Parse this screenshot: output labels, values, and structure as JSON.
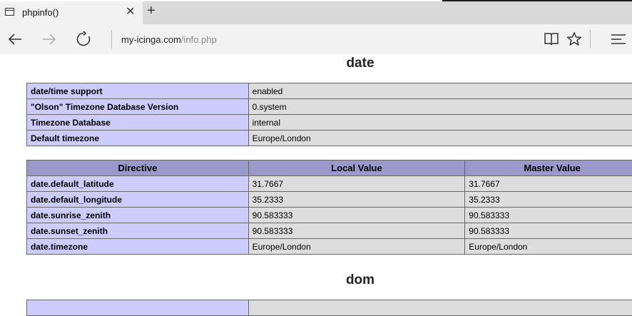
{
  "tab": {
    "title": "phpinfo()",
    "close": "✕",
    "new_tab": "+"
  },
  "address": {
    "host": "my-icinga.com",
    "path": "/info.php"
  },
  "sections": {
    "date_title": "date",
    "dom_title": "dom"
  },
  "date_info": [
    {
      "name": "date/time support",
      "value": "enabled"
    },
    {
      "name": "\"Olson\" Timezone Database Version",
      "value": "0.system"
    },
    {
      "name": "Timezone Database",
      "value": "internal"
    },
    {
      "name": "Default timezone",
      "value": "Europe/London"
    }
  ],
  "directives": {
    "headers": [
      "Directive",
      "Local Value",
      "Master Value"
    ],
    "rows": [
      {
        "name": "date.default_latitude",
        "local": "31.7667",
        "master": "31.7667"
      },
      {
        "name": "date.default_longitude",
        "local": "35.2333",
        "master": "35.2333"
      },
      {
        "name": "date.sunrise_zenith",
        "local": "90.583333",
        "master": "90.583333"
      },
      {
        "name": "date.sunset_zenith",
        "local": "90.583333",
        "master": "90.583333"
      },
      {
        "name": "date.timezone",
        "local": "Europe/London",
        "master": "Europe/London"
      }
    ]
  },
  "icons": [
    "page-icon",
    "close-icon",
    "plus-icon",
    "back-arrow-icon",
    "forward-arrow-icon",
    "refresh-icon",
    "reading-view-icon",
    "favorite-star-icon",
    "hub-menu-icon"
  ]
}
